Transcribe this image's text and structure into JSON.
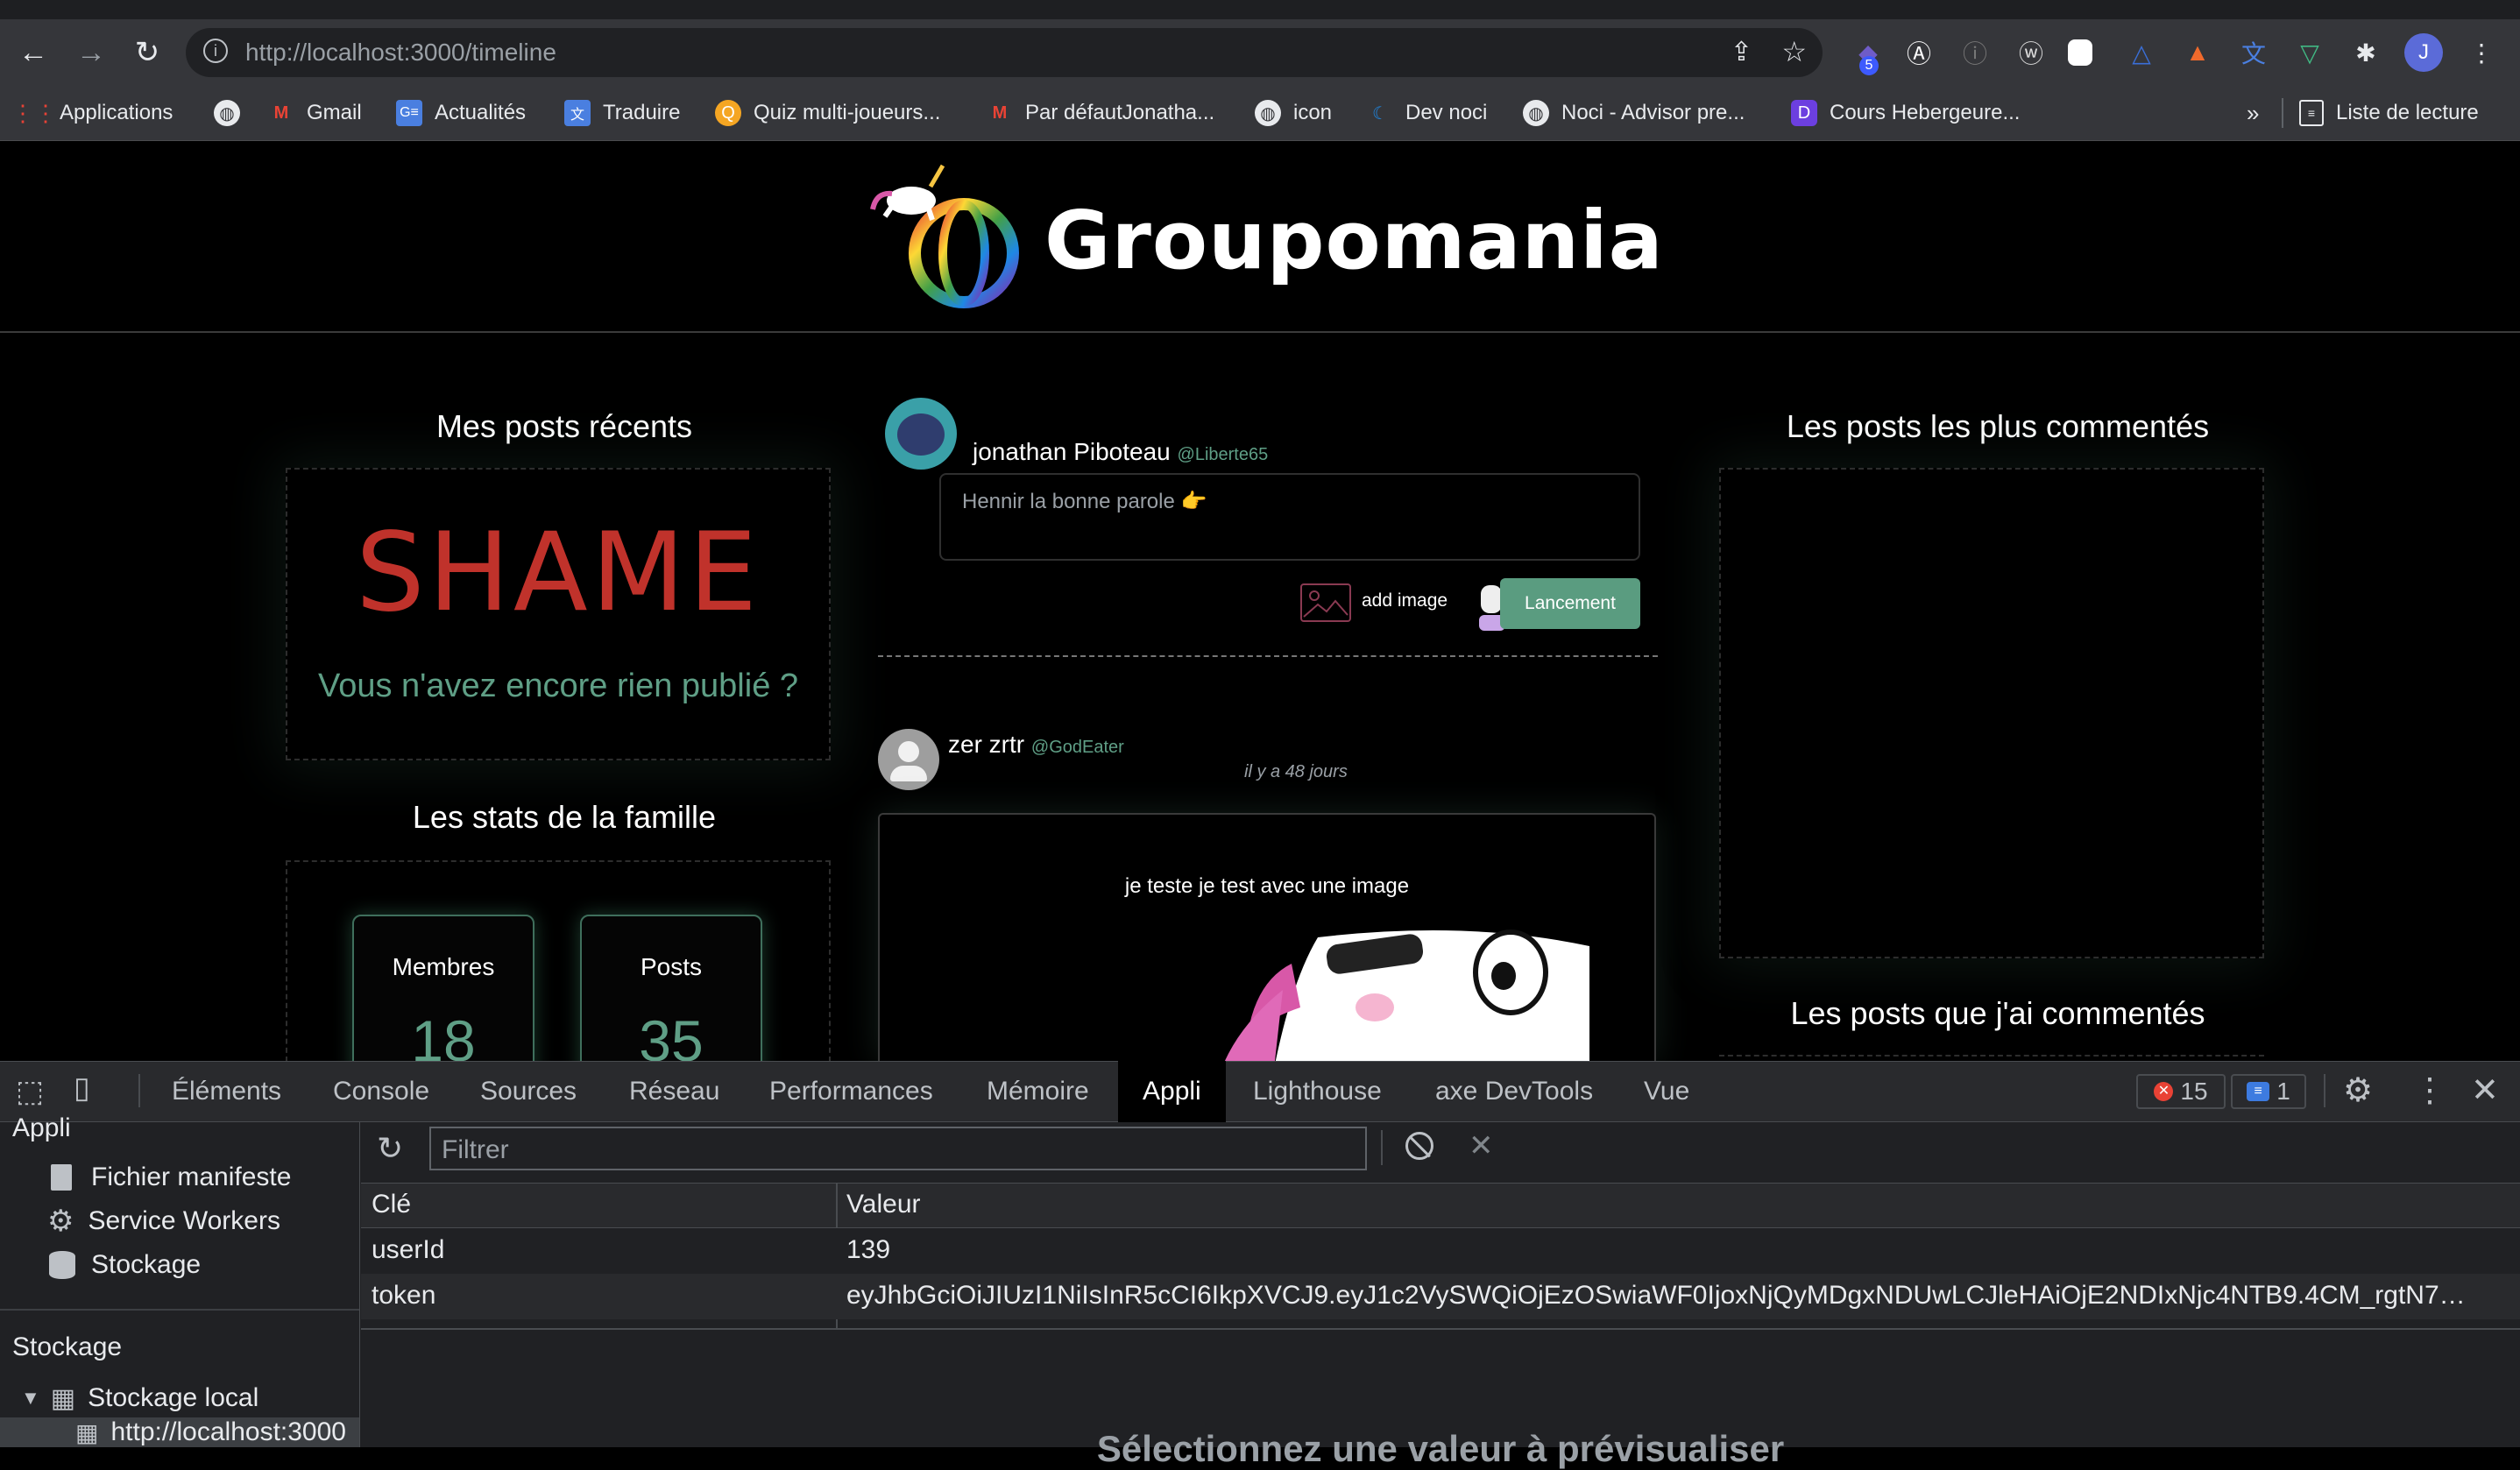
{
  "browser": {
    "url": "http://localhost:3000/timeline",
    "url_host": "http://localhost",
    "url_path": ":3000/timeline",
    "extensions_badge": "5",
    "profile_initial": "J",
    "bookmarks": [
      {
        "label": "Applications",
        "icon": "apps-grid-icon"
      },
      {
        "label": "",
        "icon": "globe-icon"
      },
      {
        "label": "Gmail",
        "icon": "gmail-icon"
      },
      {
        "label": "Actualités",
        "icon": "news-icon"
      },
      {
        "label": "Traduire",
        "icon": "translate-icon"
      },
      {
        "label": "Quiz multi-joueurs...",
        "icon": "quiz-icon"
      },
      {
        "label": "Par défautJonatha...",
        "icon": "gmail-icon"
      },
      {
        "label": "icon",
        "icon": "globe-icon"
      },
      {
        "label": "Dev noci",
        "icon": "moon-icon"
      },
      {
        "label": "Noci - Advisor pre...",
        "icon": "globe-icon"
      },
      {
        "label": "Cours Hebergeure...",
        "icon": "d-logo-icon"
      }
    ],
    "overflow": "»",
    "reading_list": "Liste de lecture"
  },
  "site": {
    "name": "Groupomania",
    "left": {
      "recent_title": "Mes posts récents",
      "shame_text": "SHAME",
      "empty_message": "Vous n'avez encore rien publié ?",
      "stats_title": "Les stats de la famille",
      "stats": [
        {
          "label": "Membres",
          "value": "18"
        },
        {
          "label": "Posts",
          "value": "35"
        }
      ]
    },
    "composer": {
      "user_name": "jonathan Piboteau",
      "user_handle": "@Liberte65",
      "placeholder": "Hennir la bonne parole 👉",
      "add_image_label": "add image",
      "submit_label": "Lancement"
    },
    "post": {
      "author_name": "zer zrtr",
      "author_handle": "@GodEater",
      "time": "il y a 48 jours",
      "text": "je teste je test avec une image"
    },
    "right": {
      "most_commented_title": "Les posts les plus commentés",
      "my_commented_title": "Les posts que j'ai commentés"
    }
  },
  "devtools": {
    "tabs": [
      "Éléments",
      "Console",
      "Sources",
      "Réseau",
      "Performances",
      "Mémoire",
      "Appli",
      "Lighthouse",
      "axe DevTools",
      "Vue"
    ],
    "active_tab": "Appli",
    "error_count": "15",
    "message_count": "1",
    "sidebar": {
      "section_app": "Appli",
      "app_items": [
        "Fichier manifeste",
        "Service Workers",
        "Stockage"
      ],
      "section_storage": "Stockage",
      "local_storage": "Stockage local",
      "local_storage_origin": "http://localhost:3000"
    },
    "filter_placeholder": "Filtrer",
    "table": {
      "col_key": "Clé",
      "col_value": "Valeur",
      "rows": [
        {
          "key": "userId",
          "value": "139"
        },
        {
          "key": "token",
          "value": "eyJhbGciOiJIUzI1NiIsInR5cCI6IkpXVCJ9.eyJ1c2VySWQiOjEzOSwiaWF0IjoxNjQyMDgxNDUwLCJleHAiOjE2NDIxNjc4NTB9.4CM_rgtN7D..."
        }
      ]
    },
    "empty_hint": "Sélectionnez une valeur à prévisualiser"
  },
  "colors": {
    "accent_green": "#5f9f86",
    "shame_red": "#c0322b",
    "button_green": "#5a9c80"
  }
}
